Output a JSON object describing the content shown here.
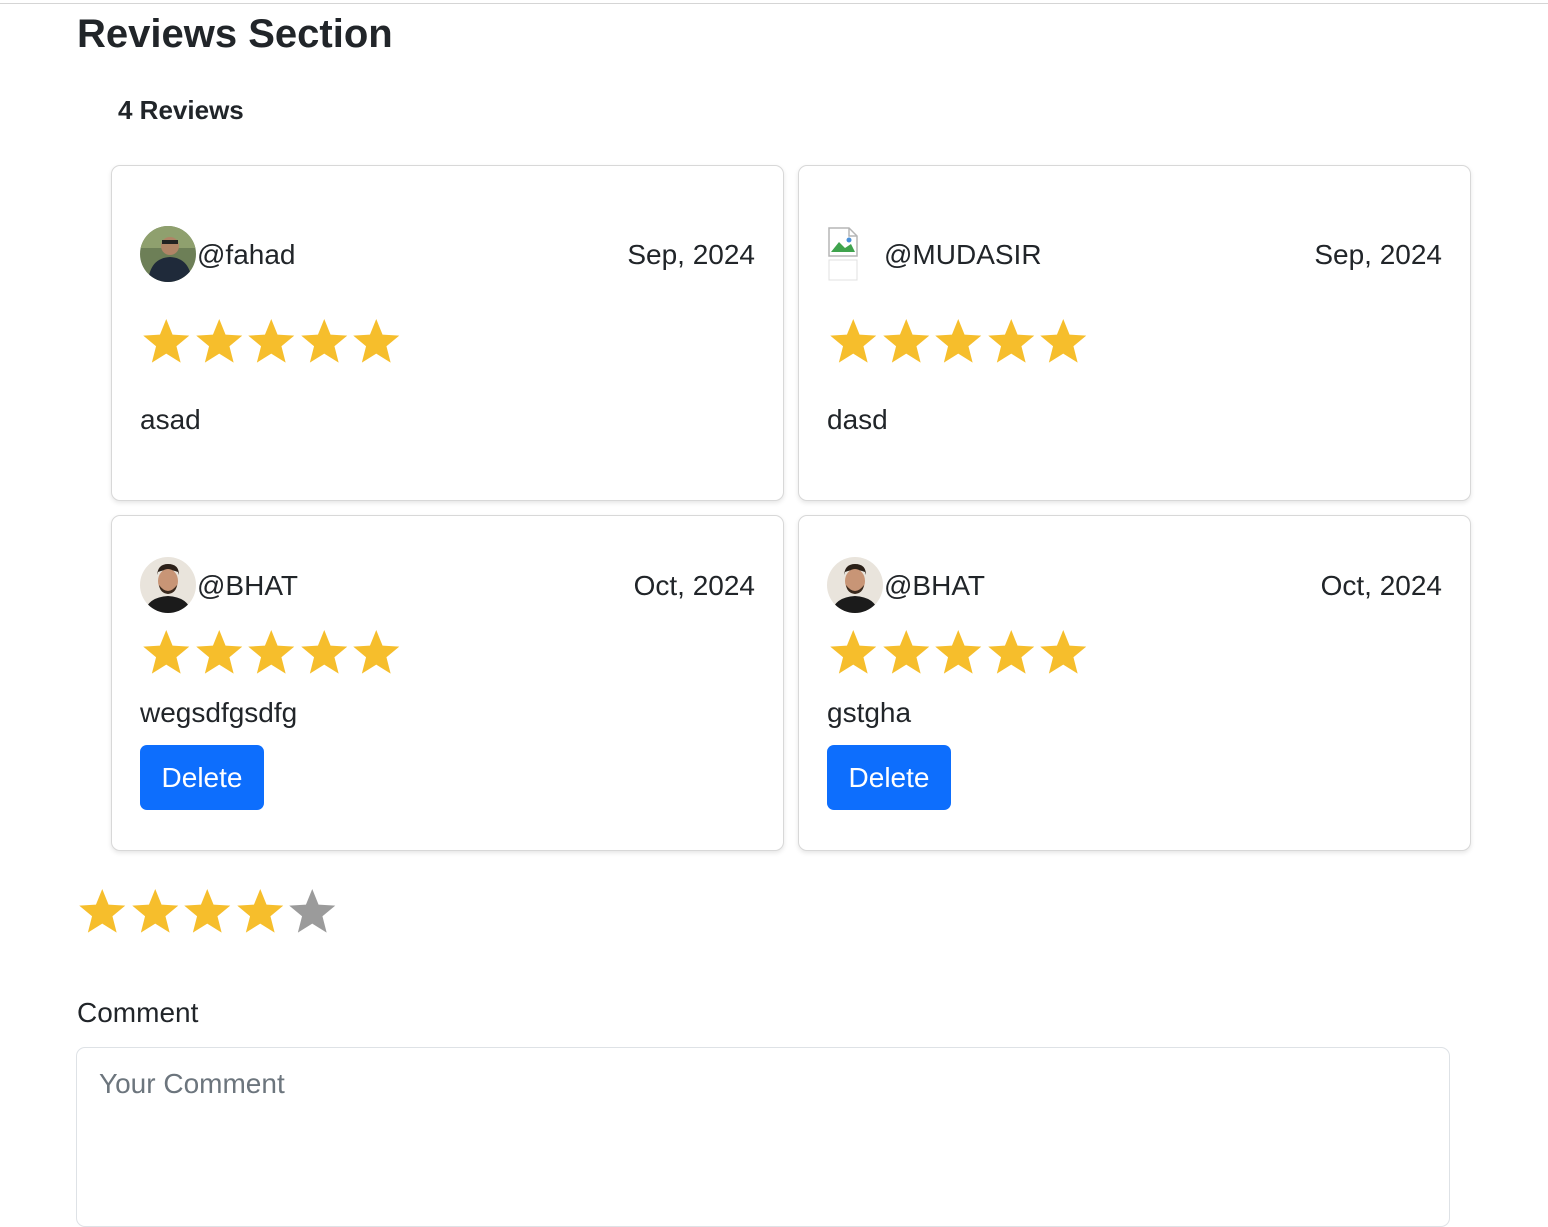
{
  "page": {
    "title": "Reviews Section",
    "review_count_label": "4 Reviews"
  },
  "colors": {
    "star_filled": "#f6be2c",
    "star_empty": "#9b9b9b",
    "delete_button": "#0d6efd"
  },
  "reviews": [
    {
      "username": "@fahad",
      "date": "Sep, 2024",
      "rating": 5,
      "comment": "asad",
      "avatar": "user-photo",
      "has_delete": false
    },
    {
      "username": "@MUDASIR",
      "date": "Sep, 2024",
      "rating": 5,
      "comment": "dasd",
      "avatar": "broken-image-icon",
      "has_delete": false
    },
    {
      "username": "@BHAT",
      "date": "Oct, 2024",
      "rating": 5,
      "comment": "wegsdfgsdfg",
      "avatar": "user-photo",
      "has_delete": true,
      "delete_label": "Delete"
    },
    {
      "username": "@BHAT",
      "date": "Oct, 2024",
      "rating": 5,
      "comment": "gstgha",
      "avatar": "user-photo",
      "has_delete": true,
      "delete_label": "Delete"
    }
  ],
  "new_review": {
    "rating": 4,
    "rating_max": 5,
    "comment_label": "Comment",
    "comment_placeholder": "Your Comment",
    "comment_value": ""
  }
}
